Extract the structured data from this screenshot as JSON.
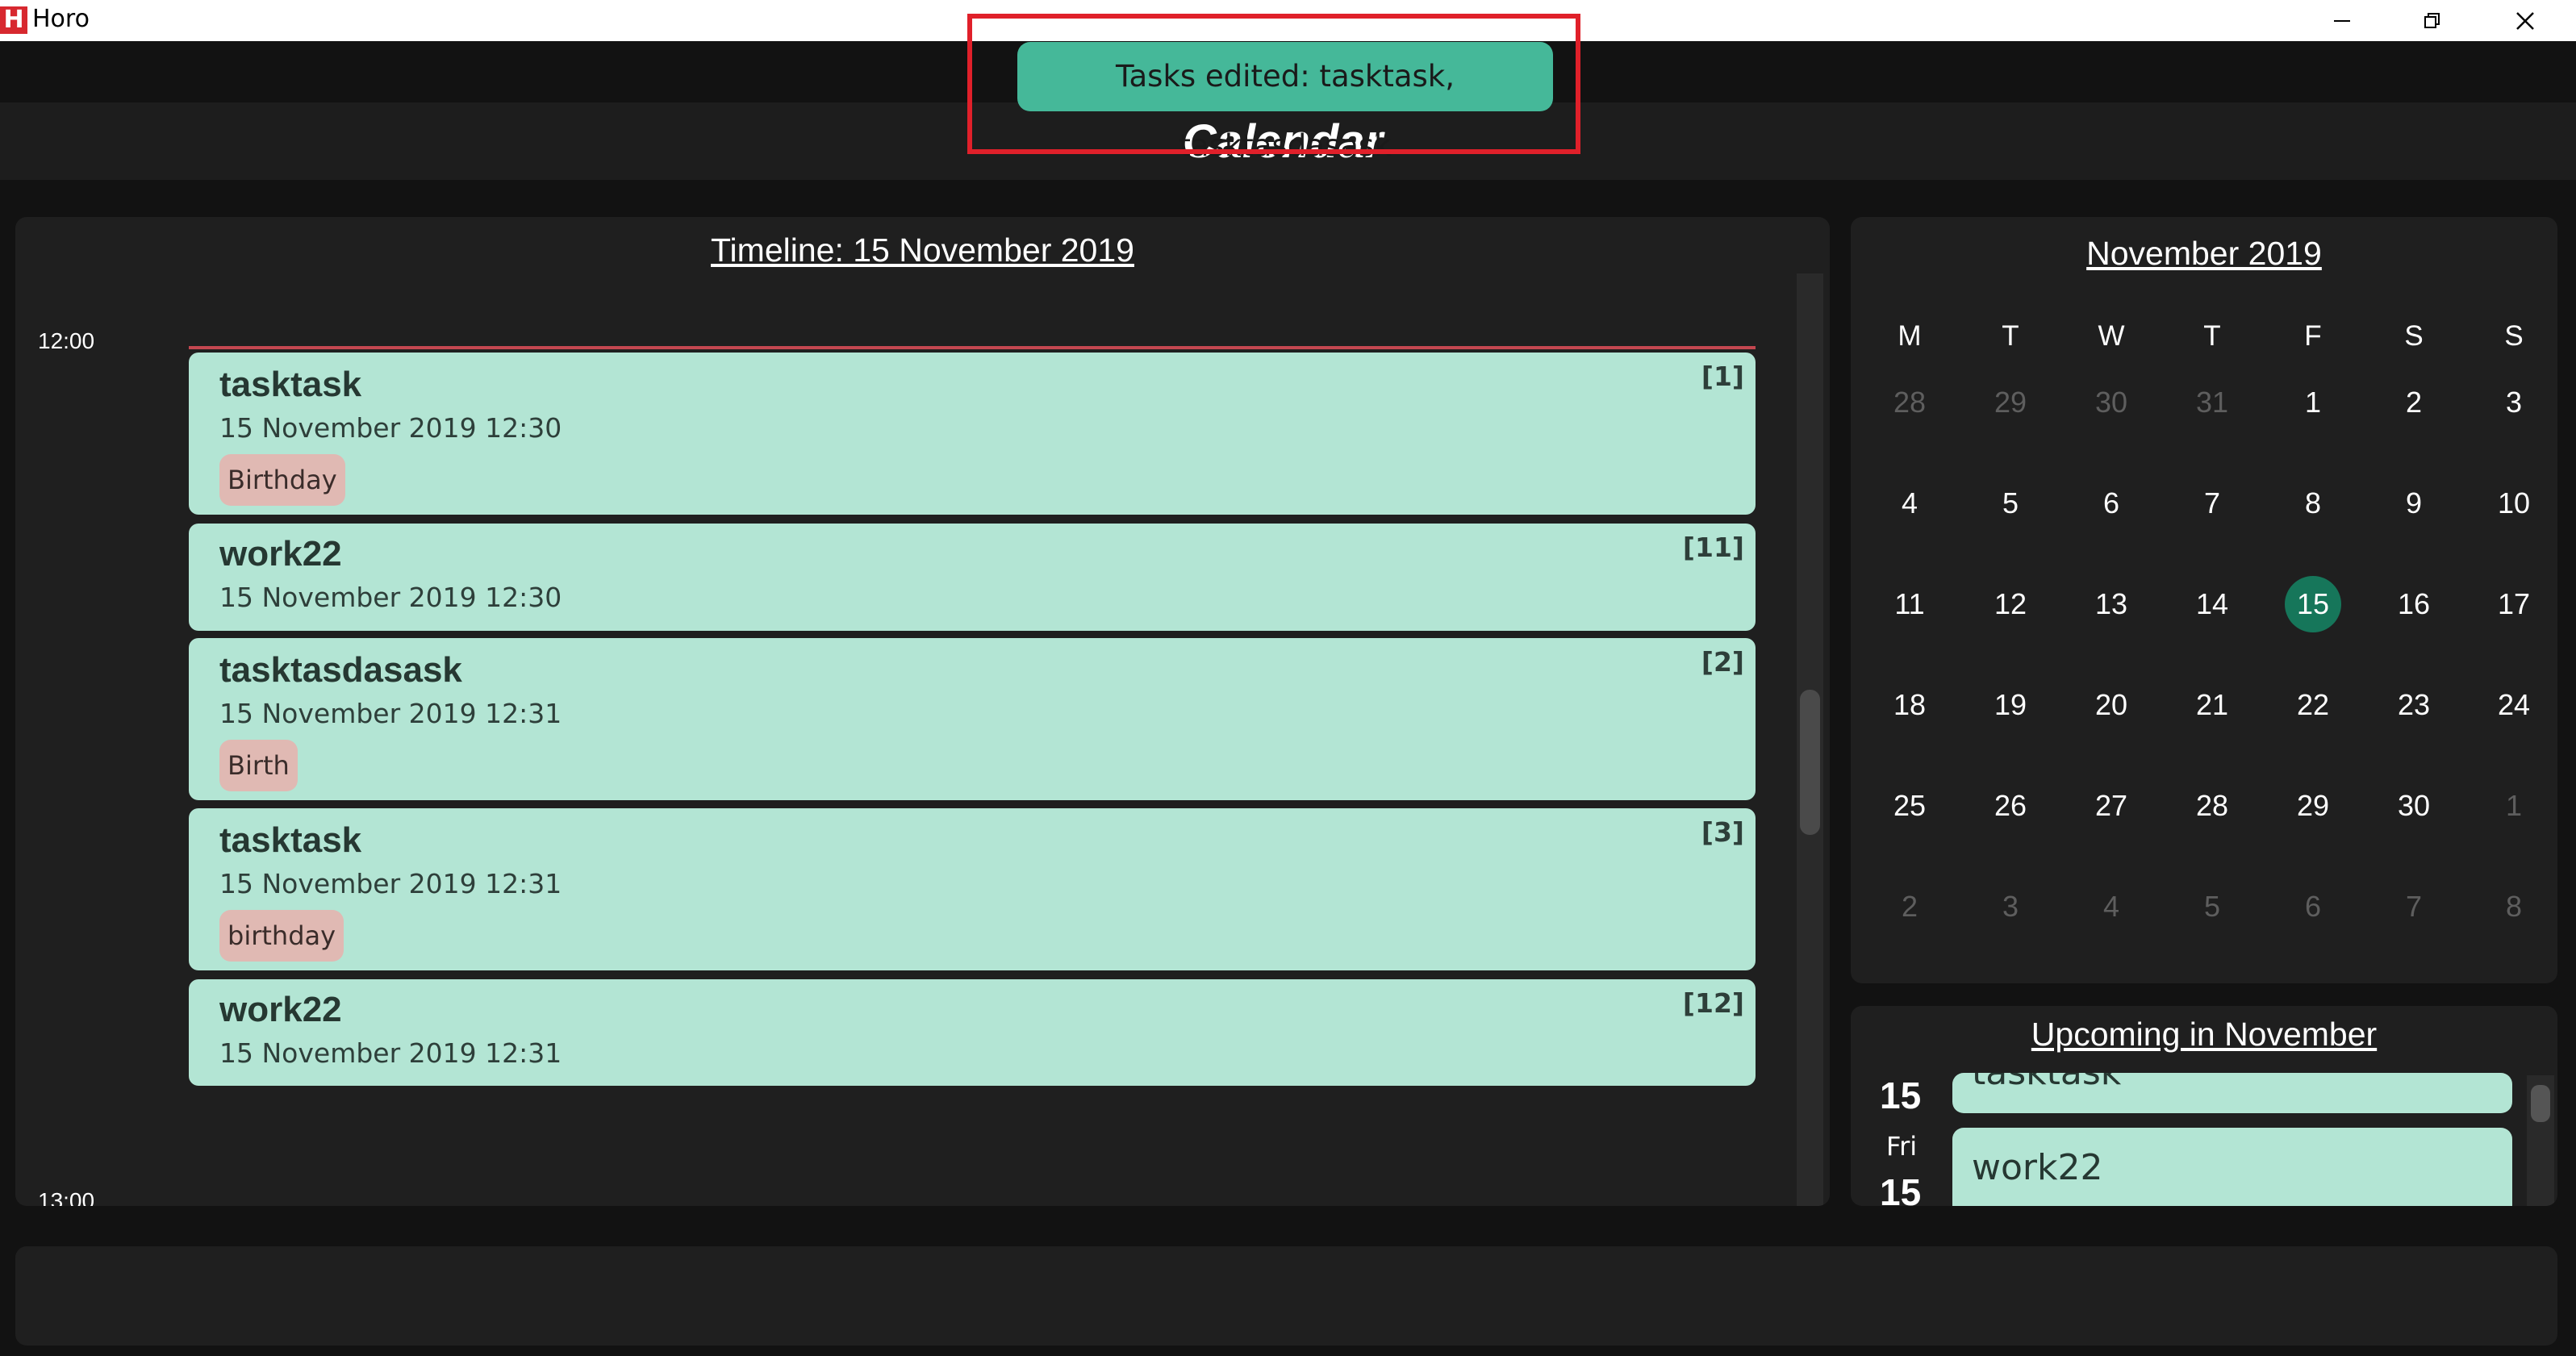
{
  "window": {
    "logo_letter": "H",
    "title": "Horo",
    "minimize_icon": "minimize-icon",
    "restore_icon": "restore-icon",
    "close_icon": "close-icon"
  },
  "header": {
    "page_title": "Calendar",
    "toast": "Tasks edited: tasktask, tasktasdasask",
    "highlight_color": "#e0202a"
  },
  "timeline": {
    "title": "Timeline: 15 November 2019",
    "time_labels": [
      "12:00",
      "13:00"
    ],
    "tasks": [
      {
        "name": "tasktask",
        "date": "15 November 2019 12:30",
        "index": "[1]",
        "tag": "Birthday"
      },
      {
        "name": "work22",
        "date": "15 November 2019 12:30",
        "index": "[11]",
        "tag": null
      },
      {
        "name": "tasktasdasask",
        "date": "15 November 2019 12:31",
        "index": "[2]",
        "tag": "Birth"
      },
      {
        "name": "tasktask",
        "date": "15 November 2019 12:31",
        "index": "[3]",
        "tag": "birthday"
      },
      {
        "name": "work22",
        "date": "15 November 2019 12:31",
        "index": "[12]",
        "tag": null
      }
    ]
  },
  "calendar": {
    "title": "November 2019",
    "weekdays": [
      "M",
      "T",
      "W",
      "T",
      "F",
      "S",
      "S"
    ],
    "weeks": [
      [
        "28",
        "29",
        "30",
        "31",
        "1",
        "2",
        "3"
      ],
      [
        "4",
        "5",
        "6",
        "7",
        "8",
        "9",
        "10"
      ],
      [
        "11",
        "12",
        "13",
        "14",
        "15",
        "16",
        "17"
      ],
      [
        "18",
        "19",
        "20",
        "21",
        "22",
        "23",
        "24"
      ],
      [
        "25",
        "26",
        "27",
        "28",
        "29",
        "30",
        "1"
      ],
      [
        "2",
        "3",
        "4",
        "5",
        "6",
        "7",
        "8"
      ]
    ],
    "selected_day": "15",
    "accent_color": "#16765a"
  },
  "upcoming": {
    "title": "Upcoming in November",
    "entries": [
      {
        "date": "15",
        "weekday": "",
        "task": "tasktask"
      },
      {
        "date": "15",
        "weekday": "Fri",
        "task": "work22"
      }
    ]
  },
  "colors": {
    "task_card": "#b3e5d4",
    "tag": "#e0b9b3",
    "toast": "#45b899",
    "background": "#121212",
    "panel": "#1f1f1f"
  }
}
